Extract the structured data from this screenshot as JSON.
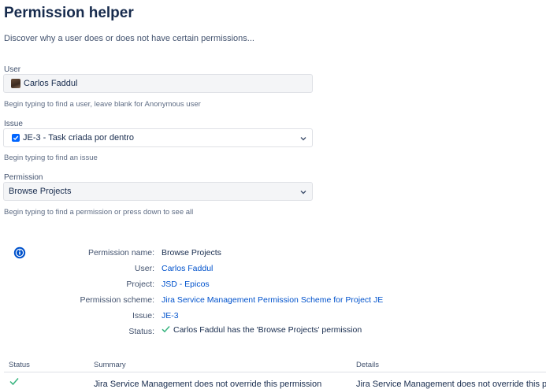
{
  "page": {
    "title": "Permission helper",
    "subtitle": "Discover why a user does or does not have certain permissions..."
  },
  "form": {
    "user": {
      "label": "User",
      "value": "Carlos Faddul",
      "help": "Begin typing to find a user, leave blank for Anonymous user"
    },
    "issue": {
      "label": "Issue",
      "value": "JE-3 - Task criada por dentro",
      "help": "Begin typing to find an issue"
    },
    "permission": {
      "label": "Permission",
      "value": "Browse Projects",
      "help": "Begin typing to find a permission or press down to see all"
    }
  },
  "result": {
    "permission_name_label": "Permission name:",
    "permission_name": "Browse Projects",
    "user_label": "User:",
    "user": "Carlos Faddul",
    "project_label": "Project:",
    "project": "JSD - Epicos",
    "scheme_label": "Permission scheme:",
    "scheme": "Jira Service Management Permission Scheme for Project JE",
    "issue_label": "Issue:",
    "issue": "JE-3",
    "status_label": "Status:",
    "status": "Carlos Faddul has the 'Browse Projects' permission"
  },
  "table": {
    "headers": {
      "status": "Status",
      "summary": "Summary",
      "details": "Details"
    },
    "rows": [
      {
        "summary": "Jira Service Management does not override this permission",
        "details": "Jira Service Management does not override this p"
      }
    ]
  },
  "colors": {
    "accent": "#0052cc",
    "success": "#36b37e",
    "checkbox": "#0065ff"
  },
  "icons": {
    "info": "info-icon",
    "check": "check-icon",
    "chevron": "chevron-down-icon"
  }
}
